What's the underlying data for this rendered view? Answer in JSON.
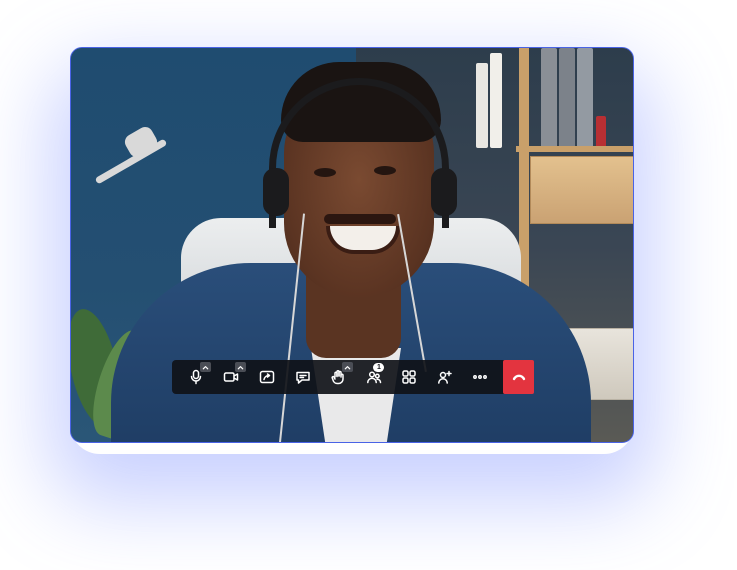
{
  "call": {
    "participant_count_badge": "1"
  },
  "toolbar": {
    "buttons": [
      {
        "icon": "microphone-icon",
        "has_options": true
      },
      {
        "icon": "camera-icon",
        "has_options": true
      },
      {
        "icon": "share-screen-icon",
        "has_options": false
      },
      {
        "icon": "chat-icon",
        "has_options": false
      },
      {
        "icon": "raise-hand-icon",
        "has_options": true
      },
      {
        "icon": "participants-icon",
        "has_options": false
      },
      {
        "icon": "layout-grid-icon",
        "has_options": false
      },
      {
        "icon": "add-person-icon",
        "has_options": false
      },
      {
        "icon": "more-options-icon",
        "has_options": false
      },
      {
        "icon": "end-call-icon",
        "has_options": false
      }
    ],
    "colors": {
      "background": "#101218",
      "end_call": "#e3343f",
      "icon": "#ffffff"
    }
  },
  "frame": {
    "border_color": "#4a63e6",
    "glow_color": "#788cff"
  }
}
